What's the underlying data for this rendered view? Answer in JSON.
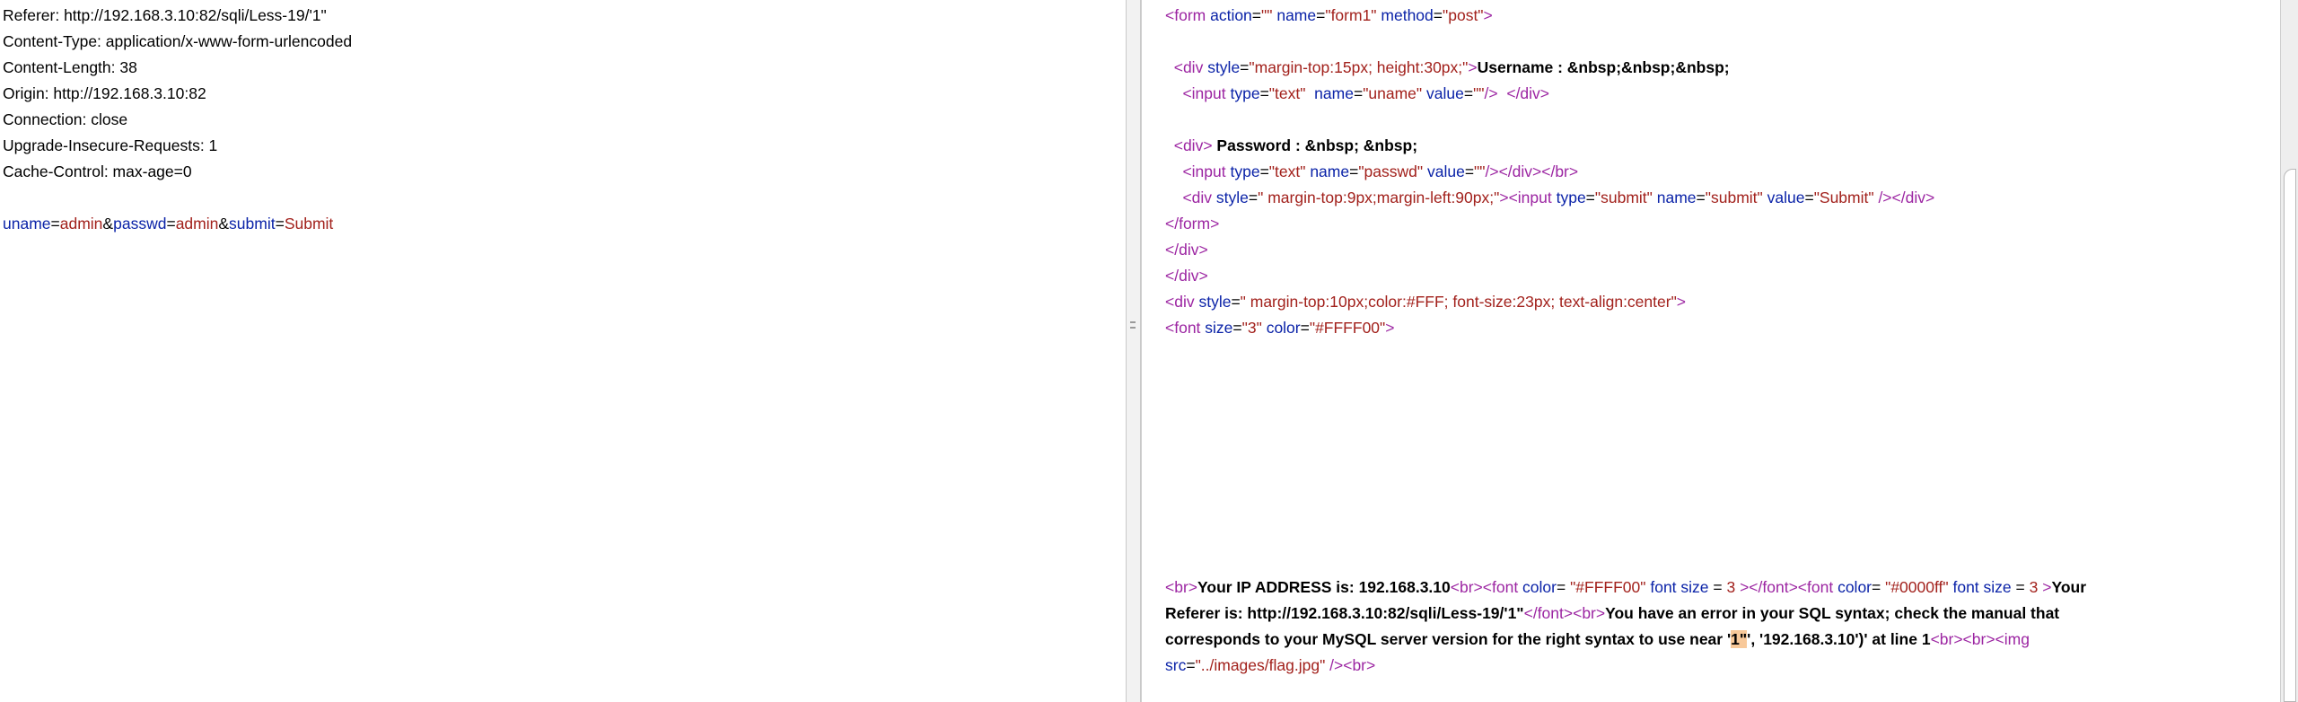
{
  "request": {
    "headers": [
      "Referer: http://192.168.3.10:82/sqli/Less-19/'1\"",
      "Content-Type: application/x-www-form-urlencoded",
      "Content-Length: 38",
      "Origin: http://192.168.3.10:82",
      "Connection: close",
      "Upgrade-Insecure-Requests: 1",
      "Cache-Control: max-age=0"
    ],
    "body": [
      {
        "t": "attr",
        "v": "uname"
      },
      {
        "t": "txt",
        "v": "="
      },
      {
        "t": "val",
        "v": "admin"
      },
      {
        "t": "txt",
        "v": "&"
      },
      {
        "t": "attr",
        "v": "passwd"
      },
      {
        "t": "txt",
        "v": "="
      },
      {
        "t": "val",
        "v": "admin"
      },
      {
        "t": "txt",
        "v": "&"
      },
      {
        "t": "attr",
        "v": "submit"
      },
      {
        "t": "txt",
        "v": "="
      },
      {
        "t": "val",
        "v": "Submit"
      }
    ]
  },
  "response": {
    "lines": [
      [
        {
          "t": "tag",
          "v": "<form "
        },
        {
          "t": "attr",
          "v": "action"
        },
        {
          "t": "txt",
          "v": "="
        },
        {
          "t": "val",
          "v": "\"\""
        },
        {
          "t": "txt",
          "v": " "
        },
        {
          "t": "attr",
          "v": "name"
        },
        {
          "t": "txt",
          "v": "="
        },
        {
          "t": "val",
          "v": "\"form1\""
        },
        {
          "t": "txt",
          "v": " "
        },
        {
          "t": "attr",
          "v": "method"
        },
        {
          "t": "txt",
          "v": "="
        },
        {
          "t": "val",
          "v": "\"post\""
        },
        {
          "t": "tag",
          "v": ">"
        }
      ],
      [],
      [
        {
          "t": "txt",
          "v": "  "
        },
        {
          "t": "tag",
          "v": "<div "
        },
        {
          "t": "attr",
          "v": "style"
        },
        {
          "t": "txt",
          "v": "="
        },
        {
          "t": "val",
          "v": "\"margin-top:15px; height:30px;\""
        },
        {
          "t": "tag",
          "v": ">"
        },
        {
          "t": "bold",
          "v": "Username : &nbsp;&nbsp;&nbsp;"
        }
      ],
      [
        {
          "t": "txt",
          "v": "    "
        },
        {
          "t": "tag",
          "v": "<input "
        },
        {
          "t": "attr",
          "v": "type"
        },
        {
          "t": "txt",
          "v": "="
        },
        {
          "t": "val",
          "v": "\"text\""
        },
        {
          "t": "txt",
          "v": "  "
        },
        {
          "t": "attr",
          "v": "name"
        },
        {
          "t": "txt",
          "v": "="
        },
        {
          "t": "val",
          "v": "\"uname\""
        },
        {
          "t": "txt",
          "v": " "
        },
        {
          "t": "attr",
          "v": "value"
        },
        {
          "t": "txt",
          "v": "="
        },
        {
          "t": "val",
          "v": "\"\""
        },
        {
          "t": "tag",
          "v": "/>"
        },
        {
          "t": "txt",
          "v": "  "
        },
        {
          "t": "tag",
          "v": "</div>"
        }
      ],
      [],
      [
        {
          "t": "txt",
          "v": "  "
        },
        {
          "t": "tag",
          "v": "<div>"
        },
        {
          "t": "bold",
          "v": " Password : &nbsp; &nbsp;"
        }
      ],
      [
        {
          "t": "txt",
          "v": "    "
        },
        {
          "t": "tag",
          "v": "<input "
        },
        {
          "t": "attr",
          "v": "type"
        },
        {
          "t": "txt",
          "v": "="
        },
        {
          "t": "val",
          "v": "\"text\""
        },
        {
          "t": "txt",
          "v": " "
        },
        {
          "t": "attr",
          "v": "name"
        },
        {
          "t": "txt",
          "v": "="
        },
        {
          "t": "val",
          "v": "\"passwd\""
        },
        {
          "t": "txt",
          "v": " "
        },
        {
          "t": "attr",
          "v": "value"
        },
        {
          "t": "txt",
          "v": "="
        },
        {
          "t": "val",
          "v": "\"\""
        },
        {
          "t": "tag",
          "v": "/></div></br>"
        }
      ],
      [
        {
          "t": "txt",
          "v": "    "
        },
        {
          "t": "tag",
          "v": "<div "
        },
        {
          "t": "attr",
          "v": "style"
        },
        {
          "t": "txt",
          "v": "="
        },
        {
          "t": "val",
          "v": "\" margin-top:9px;margin-left:90px;\""
        },
        {
          "t": "tag",
          "v": "><input "
        },
        {
          "t": "attr",
          "v": "type"
        },
        {
          "t": "txt",
          "v": "="
        },
        {
          "t": "val",
          "v": "\"submit\""
        },
        {
          "t": "txt",
          "v": " "
        },
        {
          "t": "attr",
          "v": "name"
        },
        {
          "t": "txt",
          "v": "="
        },
        {
          "t": "val",
          "v": "\"submit\""
        },
        {
          "t": "txt",
          "v": " "
        },
        {
          "t": "attr",
          "v": "value"
        },
        {
          "t": "txt",
          "v": "="
        },
        {
          "t": "val",
          "v": "\"Submit\""
        },
        {
          "t": "tag",
          "v": " /></div>"
        }
      ],
      [
        {
          "t": "tag",
          "v": "</form>"
        }
      ],
      [
        {
          "t": "tag",
          "v": "</div>"
        }
      ],
      [
        {
          "t": "tag",
          "v": "</div>"
        }
      ],
      [
        {
          "t": "tag",
          "v": "<div "
        },
        {
          "t": "attr",
          "v": "style"
        },
        {
          "t": "txt",
          "v": "="
        },
        {
          "t": "val",
          "v": "\" margin-top:10px;color:#FFF; font-size:23px; text-align:center\""
        },
        {
          "t": "tag",
          "v": ">"
        }
      ],
      [
        {
          "t": "tag",
          "v": "<font "
        },
        {
          "t": "attr",
          "v": "size"
        },
        {
          "t": "txt",
          "v": "="
        },
        {
          "t": "val",
          "v": "\"3\""
        },
        {
          "t": "txt",
          "v": " "
        },
        {
          "t": "attr",
          "v": "color"
        },
        {
          "t": "txt",
          "v": "="
        },
        {
          "t": "val",
          "v": "\"#FFFF00\""
        },
        {
          "t": "tag",
          "v": ">"
        }
      ]
    ],
    "bottom_lines": [
      [
        {
          "t": "tag",
          "v": "<br>"
        },
        {
          "t": "bold",
          "v": "Your IP ADDRESS is: 192.168.3.10"
        },
        {
          "t": "tag",
          "v": "<br><font "
        },
        {
          "t": "attr",
          "v": "color"
        },
        {
          "t": "txt",
          "v": "= "
        },
        {
          "t": "val",
          "v": "\"#FFFF00\""
        },
        {
          "t": "txt",
          "v": " "
        },
        {
          "t": "attr",
          "v": "font size"
        },
        {
          "t": "txt",
          "v": " = "
        },
        {
          "t": "val",
          "v": "3"
        },
        {
          "t": "tag",
          "v": " ></font><font "
        },
        {
          "t": "attr",
          "v": "color"
        },
        {
          "t": "txt",
          "v": "= "
        },
        {
          "t": "val",
          "v": "\"#0000ff\""
        },
        {
          "t": "txt",
          "v": " "
        },
        {
          "t": "attr",
          "v": "font size"
        },
        {
          "t": "txt",
          "v": " = "
        },
        {
          "t": "val",
          "v": "3"
        },
        {
          "t": "tag",
          "v": " >"
        },
        {
          "t": "bold",
          "v": "Your"
        }
      ],
      [
        {
          "t": "bold",
          "v": "Referer is: http://192.168.3.10:82/sqli/Less-19/'1\""
        },
        {
          "t": "tag",
          "v": "</font><br>"
        },
        {
          "t": "bold",
          "v": "You have an error in your SQL syntax; check the manual that"
        }
      ],
      [
        {
          "t": "bold",
          "v": "corresponds to your MySQL server version for the right syntax to use near '"
        },
        {
          "t": "hl",
          "v": "1\""
        },
        {
          "t": "bold",
          "v": "', '192.168.3.10')' at line 1"
        },
        {
          "t": "tag",
          "v": "<br><br><img"
        }
      ],
      [
        {
          "t": "attr",
          "v": "src"
        },
        {
          "t": "txt",
          "v": "="
        },
        {
          "t": "val",
          "v": "\"../images/flag.jpg\""
        },
        {
          "t": "tag",
          "v": " /><br>"
        }
      ]
    ]
  }
}
